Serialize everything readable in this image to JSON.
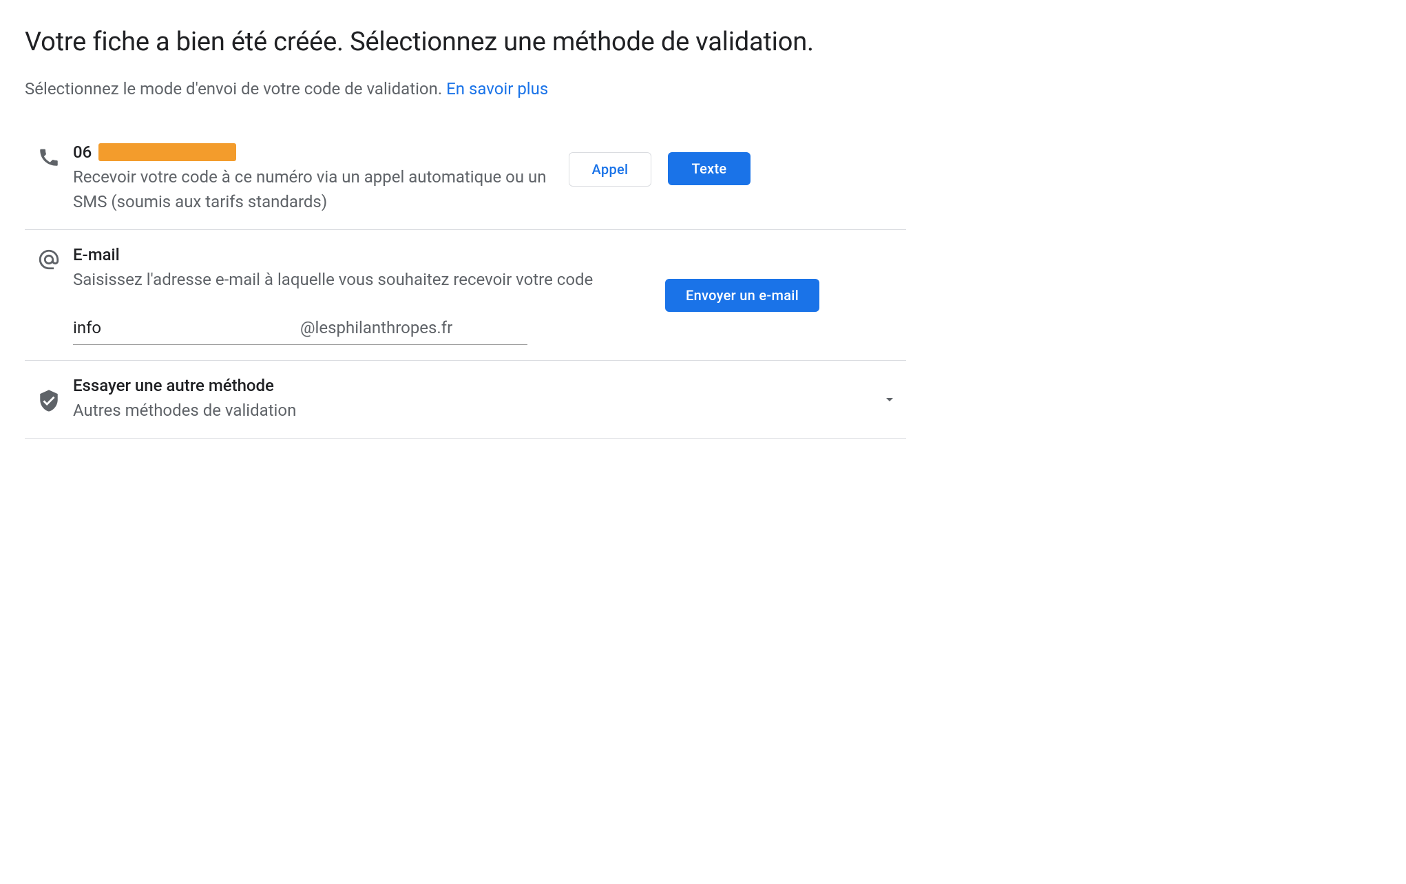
{
  "header": {
    "title": "Votre fiche a bien été créée. Sélectionnez une méthode de validation.",
    "subtitle_text": "Sélectionnez le mode d'envoi de votre code de validation. ",
    "learn_more": "En savoir plus"
  },
  "phone": {
    "number_prefix": "06",
    "description": "Recevoir votre code à ce numéro via un appel automatique ou un SMS (soumis aux tarifs standards)",
    "call_button": "Appel",
    "text_button": "Texte"
  },
  "email": {
    "title": "E-mail",
    "description": "Saisissez l'adresse e-mail à laquelle vous souhaitez recevoir votre code",
    "input_value": "info",
    "domain": "@lesphilanthropes.fr",
    "send_button": "Envoyer un e-mail"
  },
  "other": {
    "title": "Essayer une autre méthode",
    "description": "Autres méthodes de validation"
  }
}
